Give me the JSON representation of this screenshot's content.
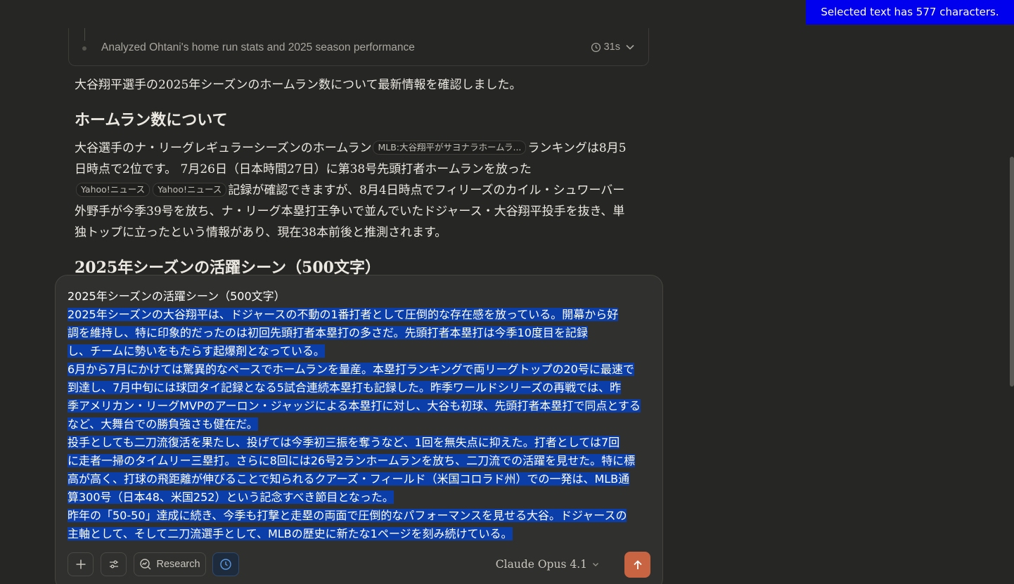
{
  "banner": {
    "text": "Selected text has 577 characters."
  },
  "thinking": {
    "summary": "Analyzed Ohtani's home run stats and 2025 season performance",
    "duration": "31s"
  },
  "response": {
    "intro": "大谷翔平選手の2025年シーズンのホームラン数について最新情報を確認しました。",
    "heading_hr": "ホームラン数について",
    "hr_part1": "大谷選手のナ・リーグレギュラーシーズンのホームラン",
    "cite1": "MLB:大谷翔平がサヨナラホームラ...",
    "hr_part2": "ランキングは8月5日時点で2位です。 7月26日（日本時間27日）に第38号先頭打者ホームランを放った",
    "cite2": "Yahoo!ニュース",
    "cite3": "Yahoo!ニュース",
    "hr_part3": "記録が確認できますが、8月4日時点でフィリーズのカイル・シュワーバー外野手が今季39号を放ち、ナ・リーグ本塁打王争いで並んでいたドジャース・大谷翔平投手を抜き、単独トップに立ったという情報があり、現在38本前後と推測されます。",
    "heading_season": "2025年シーズンの活躍シーン（500文字）"
  },
  "composer": {
    "title_line": "2025年シーズンの活躍シーン（500文字）",
    "lines": [
      "2025年シーズンの大谷翔平は、ドジャースの不動の1番打者として圧倒的な存在感を放っている。開幕から好",
      "調を維持し、特に印象的だったのは初回先頭打者本塁打の多さだ。先頭打者本塁打は今季10度目を記録",
      "し、チームに勢いをもたらす起爆剤となっている。",
      "6月から7月にかけては驚異的なペースでホームランを量産。本塁打ランキングで両リーグトップの20号に最速で",
      "到達し、7月中旬には球団タイ記録となる5試合連続本塁打も記録した。昨季ワールドシリーズの再戦では、昨",
      "季アメリカン・リーグMVPのアーロン・ジャッジによる本塁打に対し、大谷も初球、先頭打者本塁打で同点とする",
      "など、大舞台での勝負強さも健在だ。",
      "投手としても二刀流復活を果たし、投げては今季初三振を奪うなど、1回を無失点に抑えた。打者としては7回",
      "に走者一掃のタイムリー三塁打。さらに8回には26号2ランホームランを放ち、二刀流での活躍を見せた。特に標",
      "高が高く、打球の飛距離が伸びることで知られるクアーズ・フィールド（米国コロラド州）での一発は、MLB通",
      "算300号（日本48、米国252）という記念すべき節目となった。",
      "昨年の「50-50」達成に続き、今季も打撃と走塁の両面で圧倒的なパフォーマンスを見せる大谷。ドジャースの",
      "主軸として、そして二刀流選手として、MLBの歴史に新たな1ページを刻み続けている。"
    ],
    "research_label": "Research",
    "model_label": "Claude Opus 4.1"
  },
  "colors": {
    "background": "#262624",
    "selection": "#0b3ea8",
    "send_button": "#c96442",
    "banner": "#0000ee"
  },
  "icons": {
    "add": "plus-icon",
    "tools": "sliders-icon",
    "research": "research-icon",
    "extended": "clock-icon",
    "send": "arrow-up-icon",
    "model": "chevron-down-icon",
    "thinking": "clock-icon"
  }
}
